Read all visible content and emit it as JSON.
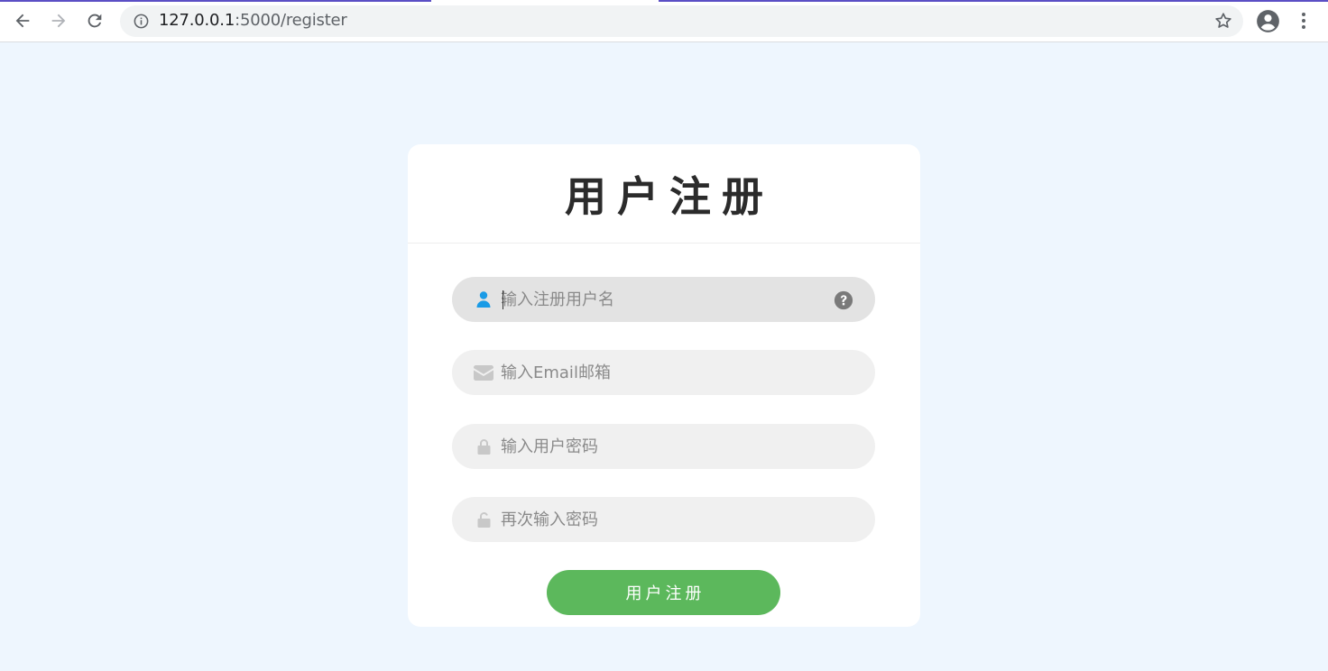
{
  "browser": {
    "url_host": "127.0.0.1",
    "url_path": ":5000/register"
  },
  "form": {
    "title": "用户注册",
    "username": {
      "placeholder": "输入注册用户名",
      "icon": "user-icon"
    },
    "email": {
      "placeholder": "输入Email邮箱",
      "icon": "envelope-icon"
    },
    "password": {
      "placeholder": "输入用户密码",
      "icon": "lock-icon"
    },
    "confirm": {
      "placeholder": "再次输入密码",
      "icon": "unlock-icon"
    },
    "submit_label": "用户注册"
  },
  "colors": {
    "page_bg": "#eef6fe",
    "accent_user_icon": "#1a9be6",
    "submit_bg": "#5cb85c",
    "field_bg": "#f0f0f0"
  }
}
